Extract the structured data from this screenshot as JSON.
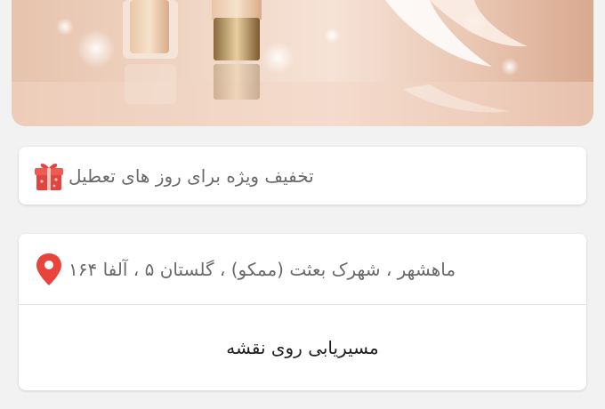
{
  "banner": {
    "image": "cosmetics-foundation-banner"
  },
  "promo": {
    "icon": "gift-icon",
    "text": "تخفیف ویژه برای روز های تعطیل"
  },
  "location": {
    "icon": "map-pin-icon",
    "address": "ماهشهر ، شهرک بعثت (ممکو) ، گلستان ۵ ، آلفا ۱۶۴",
    "route_label": "مسیریابی روی نقشه"
  },
  "colors": {
    "pin": "#e8443c",
    "gift": "#e2443f",
    "text": "#6a6a6a"
  }
}
